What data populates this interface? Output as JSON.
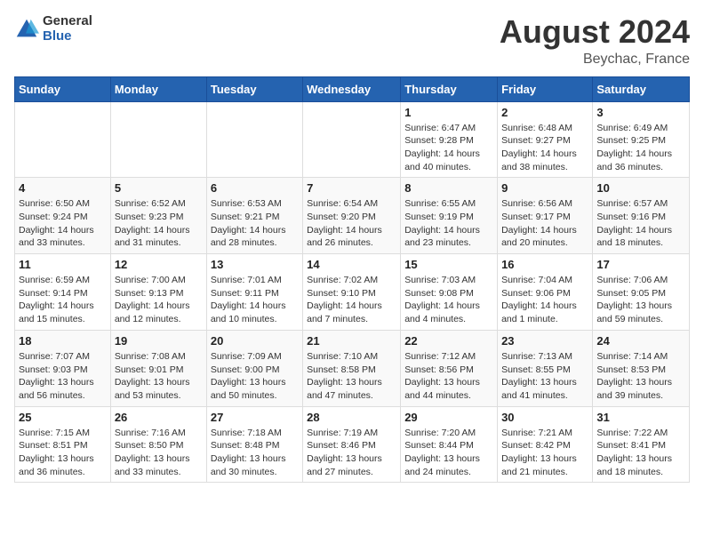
{
  "header": {
    "logo_general": "General",
    "logo_blue": "Blue",
    "month_year": "August 2024",
    "location": "Beychac, France"
  },
  "days_of_week": [
    "Sunday",
    "Monday",
    "Tuesday",
    "Wednesday",
    "Thursday",
    "Friday",
    "Saturday"
  ],
  "weeks": [
    [
      {
        "day": "",
        "info": ""
      },
      {
        "day": "",
        "info": ""
      },
      {
        "day": "",
        "info": ""
      },
      {
        "day": "",
        "info": ""
      },
      {
        "day": "1",
        "info": "Sunrise: 6:47 AM\nSunset: 9:28 PM\nDaylight: 14 hours\nand 40 minutes."
      },
      {
        "day": "2",
        "info": "Sunrise: 6:48 AM\nSunset: 9:27 PM\nDaylight: 14 hours\nand 38 minutes."
      },
      {
        "day": "3",
        "info": "Sunrise: 6:49 AM\nSunset: 9:25 PM\nDaylight: 14 hours\nand 36 minutes."
      }
    ],
    [
      {
        "day": "4",
        "info": "Sunrise: 6:50 AM\nSunset: 9:24 PM\nDaylight: 14 hours\nand 33 minutes."
      },
      {
        "day": "5",
        "info": "Sunrise: 6:52 AM\nSunset: 9:23 PM\nDaylight: 14 hours\nand 31 minutes."
      },
      {
        "day": "6",
        "info": "Sunrise: 6:53 AM\nSunset: 9:21 PM\nDaylight: 14 hours\nand 28 minutes."
      },
      {
        "day": "7",
        "info": "Sunrise: 6:54 AM\nSunset: 9:20 PM\nDaylight: 14 hours\nand 26 minutes."
      },
      {
        "day": "8",
        "info": "Sunrise: 6:55 AM\nSunset: 9:19 PM\nDaylight: 14 hours\nand 23 minutes."
      },
      {
        "day": "9",
        "info": "Sunrise: 6:56 AM\nSunset: 9:17 PM\nDaylight: 14 hours\nand 20 minutes."
      },
      {
        "day": "10",
        "info": "Sunrise: 6:57 AM\nSunset: 9:16 PM\nDaylight: 14 hours\nand 18 minutes."
      }
    ],
    [
      {
        "day": "11",
        "info": "Sunrise: 6:59 AM\nSunset: 9:14 PM\nDaylight: 14 hours\nand 15 minutes."
      },
      {
        "day": "12",
        "info": "Sunrise: 7:00 AM\nSunset: 9:13 PM\nDaylight: 14 hours\nand 12 minutes."
      },
      {
        "day": "13",
        "info": "Sunrise: 7:01 AM\nSunset: 9:11 PM\nDaylight: 14 hours\nand 10 minutes."
      },
      {
        "day": "14",
        "info": "Sunrise: 7:02 AM\nSunset: 9:10 PM\nDaylight: 14 hours\nand 7 minutes."
      },
      {
        "day": "15",
        "info": "Sunrise: 7:03 AM\nSunset: 9:08 PM\nDaylight: 14 hours\nand 4 minutes."
      },
      {
        "day": "16",
        "info": "Sunrise: 7:04 AM\nSunset: 9:06 PM\nDaylight: 14 hours\nand 1 minute."
      },
      {
        "day": "17",
        "info": "Sunrise: 7:06 AM\nSunset: 9:05 PM\nDaylight: 13 hours\nand 59 minutes."
      }
    ],
    [
      {
        "day": "18",
        "info": "Sunrise: 7:07 AM\nSunset: 9:03 PM\nDaylight: 13 hours\nand 56 minutes."
      },
      {
        "day": "19",
        "info": "Sunrise: 7:08 AM\nSunset: 9:01 PM\nDaylight: 13 hours\nand 53 minutes."
      },
      {
        "day": "20",
        "info": "Sunrise: 7:09 AM\nSunset: 9:00 PM\nDaylight: 13 hours\nand 50 minutes."
      },
      {
        "day": "21",
        "info": "Sunrise: 7:10 AM\nSunset: 8:58 PM\nDaylight: 13 hours\nand 47 minutes."
      },
      {
        "day": "22",
        "info": "Sunrise: 7:12 AM\nSunset: 8:56 PM\nDaylight: 13 hours\nand 44 minutes."
      },
      {
        "day": "23",
        "info": "Sunrise: 7:13 AM\nSunset: 8:55 PM\nDaylight: 13 hours\nand 41 minutes."
      },
      {
        "day": "24",
        "info": "Sunrise: 7:14 AM\nSunset: 8:53 PM\nDaylight: 13 hours\nand 39 minutes."
      }
    ],
    [
      {
        "day": "25",
        "info": "Sunrise: 7:15 AM\nSunset: 8:51 PM\nDaylight: 13 hours\nand 36 minutes."
      },
      {
        "day": "26",
        "info": "Sunrise: 7:16 AM\nSunset: 8:50 PM\nDaylight: 13 hours\nand 33 minutes."
      },
      {
        "day": "27",
        "info": "Sunrise: 7:18 AM\nSunset: 8:48 PM\nDaylight: 13 hours\nand 30 minutes."
      },
      {
        "day": "28",
        "info": "Sunrise: 7:19 AM\nSunset: 8:46 PM\nDaylight: 13 hours\nand 27 minutes."
      },
      {
        "day": "29",
        "info": "Sunrise: 7:20 AM\nSunset: 8:44 PM\nDaylight: 13 hours\nand 24 minutes."
      },
      {
        "day": "30",
        "info": "Sunrise: 7:21 AM\nSunset: 8:42 PM\nDaylight: 13 hours\nand 21 minutes."
      },
      {
        "day": "31",
        "info": "Sunrise: 7:22 AM\nSunset: 8:41 PM\nDaylight: 13 hours\nand 18 minutes."
      }
    ]
  ]
}
